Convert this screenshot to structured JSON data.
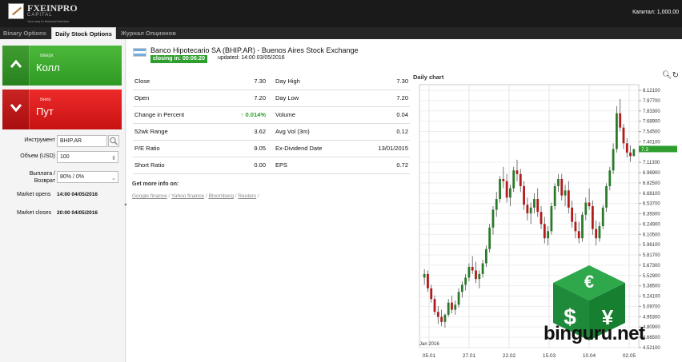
{
  "header": {
    "logo_title": "FXEINPRO",
    "logo_sub": "CAPITAL",
    "logo_tag": "Your way to financial freedom",
    "balance": "Капитал: 1,000.00"
  },
  "tabs": [
    {
      "label": "Binary Options"
    },
    {
      "label": "Daily Stock Options"
    },
    {
      "label": "Журнал Опционов"
    }
  ],
  "trade": {
    "call_small": "Вверх",
    "call_big": "Колл",
    "put_small": "Вниз",
    "put_big": "Пут",
    "instrument_label": "Инструмент",
    "instrument_value": "BHIP.AR",
    "volume_label": "Объем (USD)",
    "volume_value": "100",
    "payout_label_1": "Выплата /",
    "payout_label_2": "Возврат",
    "payout_value": "80% / 0%",
    "market_opens_label": "Market opens",
    "market_opens_value": "14:00 04/05/2016",
    "market_closes_label": "Market closes",
    "market_closes_value": "20:00 04/05/2016"
  },
  "stock": {
    "title": "Banco Hipotecario SA (BHIP.AR) - Buenos Aires Stock Exchange",
    "closing": "closing in: 00:06:20",
    "updated": "updated: 14:00 03/05/2016",
    "rows": [
      {
        "l1": "Close",
        "v1": "7.30",
        "l2": "Day High",
        "v2": "7.30"
      },
      {
        "l1": "Open",
        "v1": "7.20",
        "l2": "Day Low",
        "v2": "7.20"
      },
      {
        "l1": "Change in Percent",
        "v1": "↑ 0.014%",
        "l2": "Volume",
        "v2": "0.04"
      },
      {
        "l1": "52wk Range",
        "v1": "3.62",
        "l2": "Avg Vol (3m)",
        "v2": "0.12"
      },
      {
        "l1": "P/E Ratio",
        "v1": "9.05",
        "l2": "Ex-Dividend Date",
        "v2": "13/01/2015"
      },
      {
        "l1": "Short Ratio",
        "v1": "0.00",
        "l2": "EPS",
        "v2": "0.72"
      }
    ],
    "more_info": "Get more info on:",
    "links": [
      "Google finance",
      "Yahoo finance",
      "Bloomberg",
      "Reuters"
    ]
  },
  "chart": {
    "title": "Daily chart",
    "tools": "🔍︎↻"
  },
  "chart_data": {
    "type": "candlestick",
    "title": "Daily chart",
    "ylim": [
      4.52,
      8.2
    ],
    "yticks": [
      "8.12100",
      "7.97700",
      "7.83300",
      "7.68900",
      "7.54500",
      "7.40100",
      "7.3",
      "7.11300",
      "6.96900",
      "6.82500",
      "6.68100",
      "6.53700",
      "6.39300",
      "6.24900",
      "6.10500",
      "5.96100",
      "5.81700",
      "5.67300",
      "5.52900",
      "5.38500",
      "5.24100",
      "5.09700",
      "4.95300",
      "4.80900",
      "4.66500",
      "4.52100"
    ],
    "xticks": [
      "05.01",
      "27.01",
      "22.02",
      "15.03",
      "10.04",
      "02.05"
    ],
    "x_sublabel": "Jan 2016",
    "last_price": "7.3",
    "ohlc": [
      [
        5.5,
        5.62,
        5.4,
        5.55
      ],
      [
        5.55,
        5.6,
        5.3,
        5.35
      ],
      [
        5.35,
        5.4,
        5.15,
        5.2
      ],
      [
        5.2,
        5.25,
        4.98,
        5.02
      ],
      [
        5.02,
        5.1,
        4.85,
        4.95
      ],
      [
        4.95,
        5.05,
        4.82,
        4.88
      ],
      [
        4.88,
        5.0,
        4.8,
        4.98
      ],
      [
        4.98,
        5.2,
        4.95,
        5.15
      ],
      [
        5.15,
        5.25,
        5.0,
        5.05
      ],
      [
        5.05,
        5.18,
        4.98,
        5.12
      ],
      [
        5.12,
        5.35,
        5.08,
        5.3
      ],
      [
        5.3,
        5.45,
        5.22,
        5.4
      ],
      [
        5.4,
        5.55,
        5.32,
        5.5
      ],
      [
        5.5,
        5.7,
        5.45,
        5.65
      ],
      [
        5.65,
        5.8,
        5.55,
        5.6
      ],
      [
        5.6,
        5.72,
        5.42,
        5.48
      ],
      [
        5.48,
        5.6,
        5.35,
        5.55
      ],
      [
        5.55,
        5.75,
        5.5,
        5.7
      ],
      [
        5.7,
        5.95,
        5.65,
        5.9
      ],
      [
        5.9,
        6.25,
        5.85,
        6.2
      ],
      [
        6.2,
        6.5,
        6.1,
        6.45
      ],
      [
        6.45,
        6.7,
        6.35,
        6.6
      ],
      [
        6.6,
        6.92,
        6.55,
        6.88
      ],
      [
        6.88,
        7.05,
        6.75,
        6.85
      ],
      [
        6.85,
        6.95,
        6.55,
        6.62
      ],
      [
        6.62,
        6.8,
        6.5,
        6.75
      ],
      [
        6.75,
        7.05,
        6.7,
        7.0
      ],
      [
        7.0,
        7.15,
        6.85,
        6.95
      ],
      [
        6.95,
        7.02,
        6.7,
        6.78
      ],
      [
        6.78,
        6.85,
        6.45,
        6.52
      ],
      [
        6.52,
        6.62,
        6.3,
        6.4
      ],
      [
        6.4,
        6.55,
        6.25,
        6.48
      ],
      [
        6.48,
        6.68,
        6.4,
        6.6
      ],
      [
        6.6,
        6.75,
        6.35,
        6.42
      ],
      [
        6.42,
        6.5,
        6.18,
        6.25
      ],
      [
        6.25,
        6.35,
        5.98,
        6.05
      ],
      [
        6.05,
        6.22,
        5.95,
        6.15
      ],
      [
        6.15,
        6.55,
        6.1,
        6.5
      ],
      [
        6.5,
        6.82,
        6.45,
        6.78
      ],
      [
        6.78,
        6.95,
        6.7,
        6.88
      ],
      [
        6.88,
        6.95,
        6.58,
        6.65
      ],
      [
        6.65,
        6.8,
        6.5,
        6.72
      ],
      [
        6.72,
        6.85,
        6.4,
        6.48
      ],
      [
        6.48,
        6.58,
        6.2,
        6.28
      ],
      [
        6.28,
        6.4,
        6.05,
        6.15
      ],
      [
        6.15,
        6.28,
        5.98,
        6.05
      ],
      [
        6.05,
        6.42,
        6.0,
        6.38
      ],
      [
        6.38,
        6.62,
        6.3,
        6.55
      ],
      [
        6.55,
        6.75,
        6.45,
        6.5
      ],
      [
        6.5,
        6.58,
        6.1,
        6.18
      ],
      [
        6.18,
        6.3,
        5.95,
        6.05
      ],
      [
        6.05,
        6.28,
        6.0,
        6.22
      ],
      [
        6.22,
        6.52,
        6.18,
        6.48
      ],
      [
        6.48,
        6.82,
        6.42,
        6.78
      ],
      [
        6.78,
        7.05,
        6.72,
        7.0
      ],
      [
        7.0,
        7.38,
        6.95,
        7.3
      ],
      [
        7.3,
        7.9,
        7.25,
        7.8
      ],
      [
        7.8,
        8.0,
        7.55,
        7.6
      ],
      [
        7.6,
        7.65,
        7.3,
        7.38
      ],
      [
        7.38,
        7.45,
        7.18,
        7.25
      ],
      [
        7.25,
        7.35,
        7.12,
        7.2
      ],
      [
        7.2,
        7.3,
        7.2,
        7.3
      ]
    ]
  }
}
